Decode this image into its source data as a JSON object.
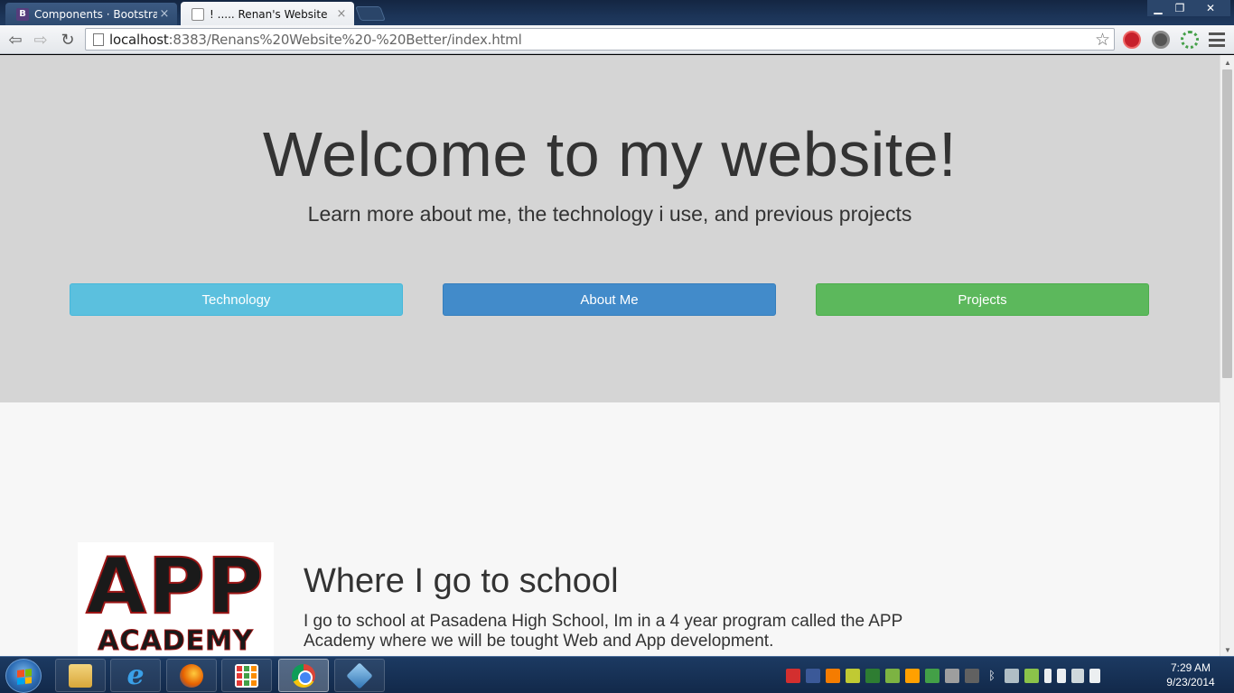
{
  "browser": {
    "tabs": [
      {
        "title": "Components · Bootstrap",
        "favicon": "B",
        "active": false
      },
      {
        "title": "! ..... Renan's Website",
        "active": true
      }
    ],
    "url_host": "localhost",
    "url_rest": ":8383/Renans%20Website%20-%20Better/index.html",
    "close_glyph": "×"
  },
  "page": {
    "hero_title": "Welcome to my website!",
    "hero_subtitle": "Learn more about me, the technology i use, and previous projects",
    "buttons": {
      "technology": "Technology",
      "about": "About Me",
      "projects": "Projects"
    },
    "school": {
      "logo_top": "APP",
      "logo_bottom": "ACADEMY",
      "heading": "Where I go to school",
      "text": "I go to school at Pasadena High School, Im in a 4 year program called the APP Academy where we will be tought Web and App development."
    }
  },
  "taskbar": {
    "time": "7:29 AM",
    "date": "9/23/2014"
  },
  "colors": {
    "btn_info": "#5bc0de",
    "btn_primary": "#428bca",
    "btn_success": "#5cb85c",
    "jumbotron_bg": "#d5d5d5"
  }
}
